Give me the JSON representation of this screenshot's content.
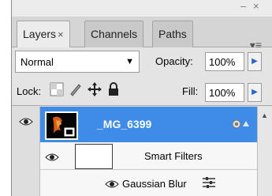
{
  "panel": {
    "minimize_glyph": "–",
    "close_glyph": "×",
    "menu_glyph": "▾≡"
  },
  "tabs": [
    {
      "label": "Layers",
      "close": "×",
      "active": true
    },
    {
      "label": "Channels",
      "active": false
    },
    {
      "label": "Paths",
      "active": false
    }
  ],
  "blend_mode": {
    "value": "Normal",
    "arrow": "▼"
  },
  "opacity": {
    "label": "Opacity:",
    "value": "100%",
    "stepper": "▶"
  },
  "lock": {
    "label": "Lock:"
  },
  "fill": {
    "label": "Fill:",
    "value": "100%",
    "stepper": "▶"
  },
  "layers": {
    "main_layer": {
      "name": "_MG_6399",
      "selected": true,
      "selected_color": "#3f8be8"
    },
    "smart_filters": {
      "label": "Smart Filters"
    },
    "gaussian_blur": {
      "label": "Gaussian Blur"
    }
  },
  "scroll": {
    "up_glyph": "▲"
  }
}
